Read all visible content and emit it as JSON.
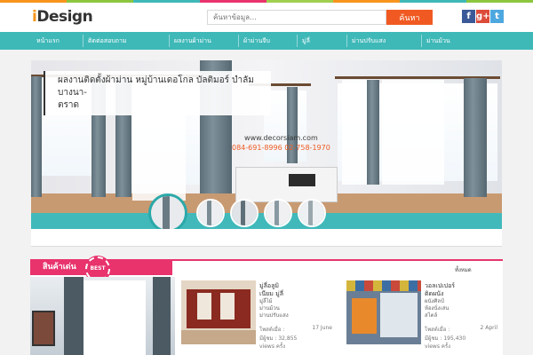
{
  "colors": {
    "stripe": [
      "#f7941d",
      "#8cc63f",
      "#3fb8b8",
      "#e8336d",
      "#a0cf4f",
      "#f7941d",
      "#3fb8b8",
      "#8cc63f"
    ],
    "accent": "#3fb8b8",
    "search_button": "#f05a22",
    "featured": "#e8336d"
  },
  "header": {
    "logo_i": "i",
    "logo_rest": "Design",
    "search_placeholder": "ค้นหาข้อมูล...",
    "search_button": "ค้นหา",
    "social": [
      {
        "icon": "facebook-icon",
        "glyph": "f",
        "color": "#3b5998"
      },
      {
        "icon": "google-plus-icon",
        "glyph": "g+",
        "color": "#dd4b39"
      },
      {
        "icon": "twitter-icon",
        "glyph": "t",
        "color": "#4ea8e0"
      }
    ]
  },
  "nav": {
    "items": [
      "หน้าแรก",
      "ติดต่อสอบถาม",
      "ผลงานผ้าม่าน",
      "ผ้าม่านจีบ",
      "มู่ลี่",
      "ม่านปรับแสง",
      "ม่านม้วน"
    ]
  },
  "slider": {
    "caption_line1": "ผลงานติดตั้งผ้าม่าน หมู่บ้านเดอโกล บัลติมอร์ บำลัม บางนา-",
    "caption_line2": "ตราด",
    "watermark_url": "www.decorsiam.com",
    "watermark_phone": "084-691-8996 02-758-1970",
    "thumb_count": 5
  },
  "featured": {
    "title": "สินค้าเด่น",
    "badge": "BEST",
    "view_all": "ทั้งหมด"
  },
  "products": [
    {
      "title_line1": "มู่ลี่อลูมิ",
      "title_line2": "เนียม มู่ลี่",
      "desc_line1": "มู่ลี่ไม้",
      "desc_line2": "ม่านม้วน",
      "desc_line3": "ม่านปรับแสง",
      "date": "17 June",
      "views_line1": "มีผู้ชม : 32,855",
      "views_line2": "views ครั้ง"
    },
    {
      "title_line1": "วอลเปเปอร์",
      "title_line2": "ติดผนัง",
      "desc_line1": "ผนังศิลป์",
      "desc_line2": "ห้องนั่งเล่น",
      "desc_line3": "สไตล์",
      "date": "2 April",
      "views_line1": "มีผู้ชม : 195,430",
      "views_line2": "views ครั้ง"
    }
  ],
  "product_date_labels": [
    "โพสต์เมื่อ :",
    "โพสต์เมื่อ :"
  ]
}
